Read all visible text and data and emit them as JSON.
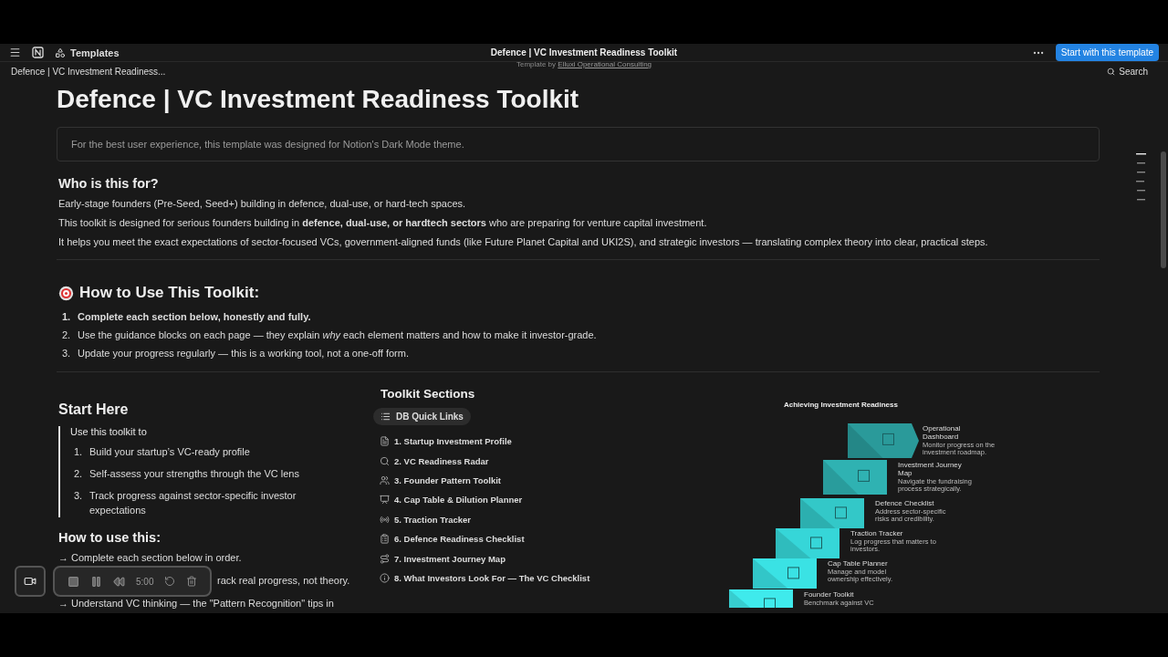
{
  "topbar": {
    "workspace": "Templates",
    "title": "Defence | VC Investment Readiness Toolkit",
    "byline": "Template by",
    "author": "Elluxi Operational Consulting",
    "cta": "Start with this template"
  },
  "breadcrumb": {
    "page": "Defence | VC Investment Readiness...",
    "search": "Search"
  },
  "page": {
    "title": "Defence | VC Investment Readiness Toolkit",
    "callout": "For the best user experience, this template was designed for Notion's Dark Mode theme.",
    "who": {
      "heading": "Who is this for?",
      "paragraphs": [
        "Early-stage founders (Pre-Seed, Seed+) building in defence, dual-use, or hard-tech spaces.",
        "This toolkit is designed for serious founders building in **defence, dual-use, or hardtech sectors** who are preparing for venture capital investment.",
        "It helps you meet the exact expectations of sector-focused VCs, government-aligned funds (like Future Planet Capital and UKI2S), and strategic investors — translating complex theory into clear, practical steps."
      ]
    },
    "howto": {
      "heading": "How to Use This Toolkit:",
      "steps": [
        {
          "number": "1.",
          "text": "Complete each section below, honestly and fully.",
          "bold": true
        },
        {
          "number": "2.",
          "text": "Use the guidance blocks on each page — they explain *why* each element matters and how to make it investor-grade.",
          "bold": false
        },
        {
          "number": "3.",
          "text": "Update your progress regularly — this is a working tool, not a one-off form.",
          "bold": false
        }
      ]
    }
  },
  "start": {
    "heading": "Start Here",
    "quote_intro": "Use this toolkit to",
    "quote_items": [
      {
        "number": "1.",
        "text": "Build your startup’s VC-ready profile"
      },
      {
        "number": "2.",
        "text": "Self-assess your strengths through the VC lens"
      },
      {
        "number": "3.",
        "text": "Track progress against sector-specific investor expectations"
      }
    ],
    "subheading": "How to use this:",
    "lines": [
      "→ Complete each section below in order.",
      "rack real progress, not theory.",
      "→ Understand VC thinking — the \"Pattern Recognition\" tips in"
    ]
  },
  "toolkit": {
    "heading": "Toolkit Sections",
    "chip": "DB Quick Links",
    "links": [
      {
        "kind": "profile",
        "label": "1. Startup Investment Profile"
      },
      {
        "kind": "search",
        "label": "2. VC Readiness Radar"
      },
      {
        "kind": "people",
        "label": "3. Founder Pattern Toolkit"
      },
      {
        "kind": "chart",
        "label": "4. Cap Table & Dilution Planner"
      },
      {
        "kind": "signal",
        "label": "5. Traction Tracker"
      },
      {
        "kind": "list",
        "label": "6. Defence Readiness Checklist"
      },
      {
        "kind": "route",
        "label": "7. Investment Journey Map"
      },
      {
        "kind": "info",
        "label": "8. What Investors Look For — The VC Checklist"
      }
    ]
  },
  "diagram": {
    "title": "Achieving Investment Readiness",
    "steps": [
      {
        "name": "Operational",
        "name2": "Dashboard",
        "desc": "Monitor progress on the",
        "desc2": "investment roadmap.",
        "color": "#2a9a9a"
      },
      {
        "name": "Investment Journey",
        "name2": "Map",
        "desc": "Navigate the fundraising",
        "desc2": "process strategically.",
        "color": "#2fb2b2"
      },
      {
        "name": "Defence Checklist",
        "desc": "Address sector-specific",
        "desc2": "risks and credibility.",
        "color": "#33c8c8"
      },
      {
        "name": "Traction Tracker",
        "desc": "Log progress that matters to",
        "desc2": "investors.",
        "color": "#36d6d8"
      },
      {
        "name": "Cap Table Planner",
        "desc": "Manage and model",
        "desc2": "ownership effectively.",
        "color": "#3ae2e4"
      },
      {
        "name": "Founder Toolkit",
        "desc": "Benchmark against VC",
        "color": "#3feaec"
      }
    ]
  },
  "recorder": {
    "time": "5:00"
  }
}
